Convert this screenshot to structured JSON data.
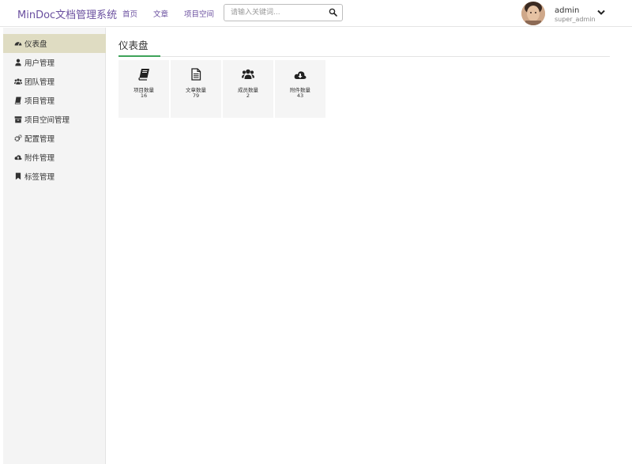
{
  "header": {
    "brand": "MinDoc文档管理系统",
    "nav": [
      {
        "label": "首页"
      },
      {
        "label": "文章"
      },
      {
        "label": "项目空间"
      }
    ],
    "search": {
      "placeholder": "请输入关键词...",
      "value": ""
    },
    "user": {
      "name": "admin",
      "role": "super_admin"
    }
  },
  "sidebar": {
    "items": [
      {
        "label": "仪表盘",
        "icon": "dashboard-icon",
        "active": true
      },
      {
        "label": "用户管理",
        "icon": "user-icon"
      },
      {
        "label": "团队管理",
        "icon": "users-icon"
      },
      {
        "label": "项目管理",
        "icon": "book-icon"
      },
      {
        "label": "项目空间管理",
        "icon": "archive-icon"
      },
      {
        "label": "配置管理",
        "icon": "gears-icon"
      },
      {
        "label": "附件管理",
        "icon": "cloud-upload-icon"
      },
      {
        "label": "标签管理",
        "icon": "bookmark-icon"
      }
    ]
  },
  "main": {
    "title": "仪表盘",
    "cards": [
      {
        "label": "项目数量",
        "value": "16",
        "icon": "book-icon"
      },
      {
        "label": "文章数量",
        "value": "79",
        "icon": "file-text-icon"
      },
      {
        "label": "成员数量",
        "value": "2",
        "icon": "users-icon"
      },
      {
        "label": "附件数量",
        "value": "43",
        "icon": "cloud-download-icon"
      }
    ]
  },
  "colors": {
    "brand": "#6a4f9f",
    "active_sidebar": "#dfdcc2",
    "accent_underline": "#3ea35a",
    "card_bg": "#f5f5f5"
  }
}
